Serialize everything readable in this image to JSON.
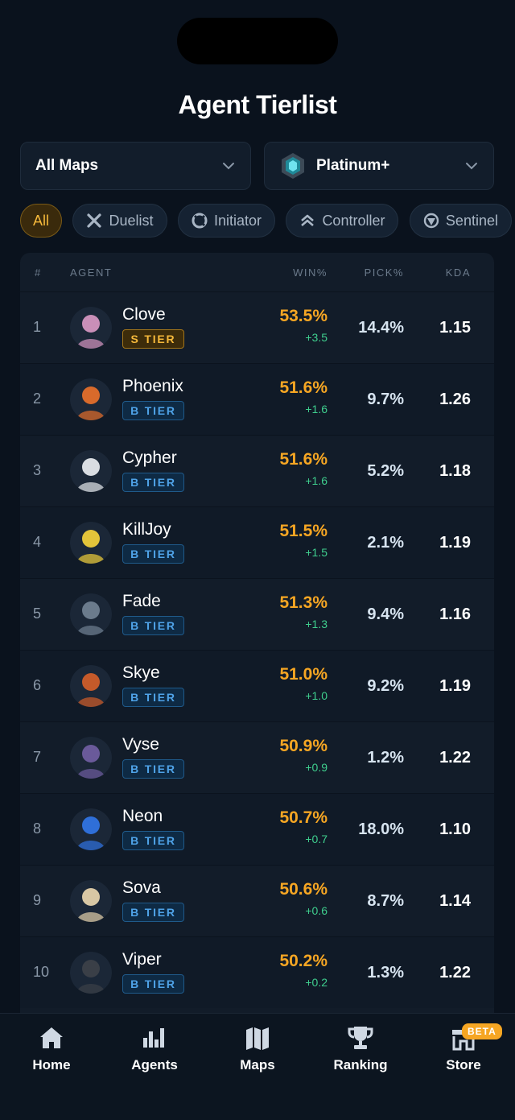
{
  "title": "Agent Tierlist",
  "filters": {
    "map": "All Maps",
    "rank": "Platinum+"
  },
  "roles": [
    {
      "label": "All",
      "icon": "none"
    },
    {
      "label": "Duelist",
      "icon": "duelist-icon"
    },
    {
      "label": "Initiator",
      "icon": "initiator-icon"
    },
    {
      "label": "Controller",
      "icon": "controller-icon"
    },
    {
      "label": "Sentinel",
      "icon": "sentinel-icon"
    }
  ],
  "table": {
    "headers": {
      "rank": "#",
      "agent": "AGENT",
      "win": "WIN%",
      "pick": "PICK%",
      "kda": "KDA"
    },
    "rows": [
      {
        "rank": "1",
        "name": "Clove",
        "tier": "S TIER",
        "tier_class": "s",
        "win": "53.5%",
        "delta": "+3.5",
        "pick": "14.4%",
        "kda": "1.15",
        "avatar_color": "#c98fb8"
      },
      {
        "rank": "2",
        "name": "Phoenix",
        "tier": "B TIER",
        "tier_class": "b",
        "win": "51.6%",
        "delta": "+1.6",
        "pick": "9.7%",
        "kda": "1.26",
        "avatar_color": "#d86a2b"
      },
      {
        "rank": "3",
        "name": "Cypher",
        "tier": "B TIER",
        "tier_class": "b",
        "win": "51.6%",
        "delta": "+1.6",
        "pick": "5.2%",
        "kda": "1.18",
        "avatar_color": "#d9dde2"
      },
      {
        "rank": "4",
        "name": "KillJoy",
        "tier": "B TIER",
        "tier_class": "b",
        "win": "51.5%",
        "delta": "+1.5",
        "pick": "2.1%",
        "kda": "1.19",
        "avatar_color": "#e3c43a"
      },
      {
        "rank": "5",
        "name": "Fade",
        "tier": "B TIER",
        "tier_class": "b",
        "win": "51.3%",
        "delta": "+1.3",
        "pick": "9.4%",
        "kda": "1.16",
        "avatar_color": "#6b7b8c"
      },
      {
        "rank": "6",
        "name": "Skye",
        "tier": "B TIER",
        "tier_class": "b",
        "win": "51.0%",
        "delta": "+1.0",
        "pick": "9.2%",
        "kda": "1.19",
        "avatar_color": "#c55a2a"
      },
      {
        "rank": "7",
        "name": "Vyse",
        "tier": "B TIER",
        "tier_class": "b",
        "win": "50.9%",
        "delta": "+0.9",
        "pick": "1.2%",
        "kda": "1.22",
        "avatar_color": "#6a5a9a"
      },
      {
        "rank": "8",
        "name": "Neon",
        "tier": "B TIER",
        "tier_class": "b",
        "win": "50.7%",
        "delta": "+0.7",
        "pick": "18.0%",
        "kda": "1.10",
        "avatar_color": "#2f6fd8"
      },
      {
        "rank": "9",
        "name": "Sova",
        "tier": "B TIER",
        "tier_class": "b",
        "win": "50.6%",
        "delta": "+0.6",
        "pick": "8.7%",
        "kda": "1.14",
        "avatar_color": "#d8c7a4"
      },
      {
        "rank": "10",
        "name": "Viper",
        "tier": "B TIER",
        "tier_class": "b",
        "win": "50.2%",
        "delta": "+0.2",
        "pick": "1.3%",
        "kda": "1.22",
        "avatar_color": "#3a3f47"
      }
    ]
  },
  "tabbar": {
    "items": [
      {
        "label": "Home",
        "icon": "home-icon"
      },
      {
        "label": "Agents",
        "icon": "bar-chart-icon"
      },
      {
        "label": "Maps",
        "icon": "map-icon"
      },
      {
        "label": "Ranking",
        "icon": "trophy-icon"
      },
      {
        "label": "Store",
        "icon": "store-icon"
      }
    ],
    "store_badge": "BETA"
  },
  "colors": {
    "background": "#0a121d",
    "accent": "#f6a623",
    "positive": "#3fcf8e",
    "tier_b": "#4fa3e8"
  }
}
